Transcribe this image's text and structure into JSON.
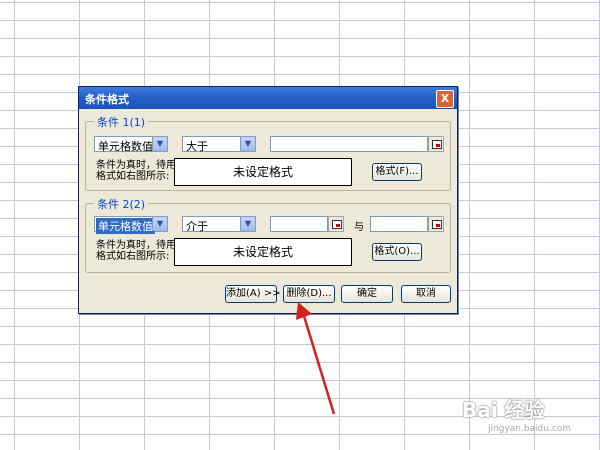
{
  "dialog": {
    "title": "条件格式",
    "close_glyph": "X"
  },
  "condition1": {
    "legend": "条件 1(1)",
    "field_value": "单元格数值",
    "operator_value": "大于",
    "condition_label": "条件为真时，待用格式如右图所示:",
    "preview_text": "未设定格式",
    "format_button": "格式(F)..."
  },
  "condition2": {
    "legend": "条件 2(2)",
    "field_value": "单元格数值",
    "operator_value": "介于",
    "and_label": "与",
    "condition_label": "条件为真时，待用格式如右图所示:",
    "preview_text": "未设定格式",
    "format_button": "格式(O)..."
  },
  "buttons": {
    "add": "添加(A) >>",
    "delete": "删除(D)...",
    "ok": "确定",
    "cancel": "取消"
  },
  "annotation": {
    "arrow_color": "#d42020"
  },
  "watermark": {
    "text": "Bai 经验",
    "sub": "jingyan.baidu.com"
  },
  "colors": {
    "titlebar": "#2460c8",
    "dialog_bg": "#ece9d8",
    "legend_text": "#0046d5"
  }
}
